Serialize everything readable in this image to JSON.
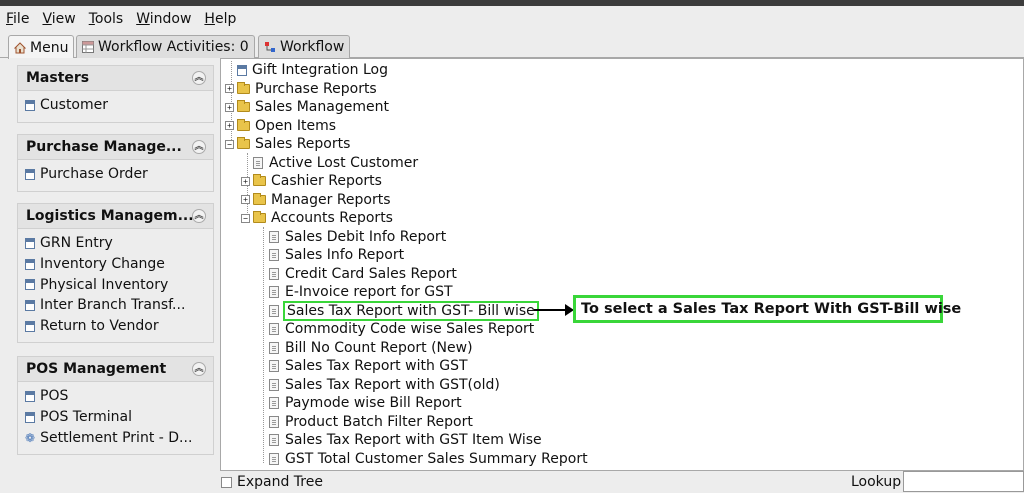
{
  "menubar": [
    "File",
    "View",
    "Tools",
    "Window",
    "Help"
  ],
  "tabs": [
    {
      "label": "Menu",
      "icon": "home-icon"
    },
    {
      "label": "Workflow Activities: 0",
      "icon": "grid-icon"
    },
    {
      "label": "Workflow",
      "icon": "workflow-icon"
    }
  ],
  "sidebar": {
    "sections": [
      {
        "title": "Masters",
        "items": [
          {
            "label": "Customer",
            "icon": "doc-icon"
          }
        ]
      },
      {
        "title": "Purchase Manage...",
        "items": [
          {
            "label": "Purchase Order",
            "icon": "doc-icon"
          }
        ]
      },
      {
        "title": "Logistics Managem...",
        "items": [
          {
            "label": "GRN Entry",
            "icon": "doc-icon"
          },
          {
            "label": "Inventory Change",
            "icon": "doc-icon"
          },
          {
            "label": "Physical Inventory",
            "icon": "doc-icon"
          },
          {
            "label": "Inter Branch Transf...",
            "icon": "doc-icon"
          },
          {
            "label": "Return to Vendor",
            "icon": "doc-icon"
          }
        ]
      },
      {
        "title": "POS Management",
        "items": [
          {
            "label": "POS",
            "icon": "doc-icon"
          },
          {
            "label": "POS Terminal",
            "icon": "doc-icon"
          },
          {
            "label": "Settlement Print - D...",
            "icon": "gear-icon"
          }
        ]
      }
    ]
  },
  "tree": [
    {
      "label": "Gift Integration Log",
      "type": "item",
      "level": 0
    },
    {
      "label": "Purchase Reports",
      "type": "folder",
      "level": 0,
      "expanded": false
    },
    {
      "label": "Sales Management",
      "type": "folder",
      "level": 0,
      "expanded": false
    },
    {
      "label": "Open Items",
      "type": "folder",
      "level": 0,
      "expanded": false
    },
    {
      "label": "Sales Reports",
      "type": "folder",
      "level": 0,
      "expanded": true
    },
    {
      "label": "Active Lost Customer",
      "type": "leaf",
      "level": 1
    },
    {
      "label": "Cashier Reports",
      "type": "folder",
      "level": 1,
      "expanded": false
    },
    {
      "label": "Manager Reports",
      "type": "folder",
      "level": 1,
      "expanded": false
    },
    {
      "label": "Accounts Reports",
      "type": "folder",
      "level": 1,
      "expanded": true
    },
    {
      "label": "Sales Debit Info Report",
      "type": "leaf",
      "level": 2
    },
    {
      "label": "Sales Info Report",
      "type": "leaf",
      "level": 2
    },
    {
      "label": "Credit Card Sales Report",
      "type": "leaf",
      "level": 2
    },
    {
      "label": "E-Invoice report for GST",
      "type": "leaf",
      "level": 2
    },
    {
      "label": "Sales Tax Report with GST- Bill wise",
      "type": "leaf",
      "level": 2,
      "highlighted": true
    },
    {
      "label": "Commodity Code wise Sales Report",
      "type": "leaf",
      "level": 2
    },
    {
      "label": "Bill No Count Report (New)",
      "type": "leaf",
      "level": 2
    },
    {
      "label": "Sales Tax Report with GST",
      "type": "leaf",
      "level": 2
    },
    {
      "label": "Sales Tax Report with GST(old)",
      "type": "leaf",
      "level": 2
    },
    {
      "label": "Paymode wise Bill Report",
      "type": "leaf",
      "level": 2
    },
    {
      "label": "Product Batch Filter Report",
      "type": "leaf",
      "level": 2
    },
    {
      "label": "Sales Tax Report with GST Item Wise",
      "type": "leaf",
      "level": 2
    },
    {
      "label": "GST Total Customer Sales Summary Report",
      "type": "leaf",
      "level": 2
    }
  ],
  "callout": {
    "text": "To select a Sales Tax Report With GST-Bill wise",
    "color": "#39d639"
  },
  "status": {
    "expand_tree": "Expand Tree",
    "lookup_label": "Lookup",
    "lookup_value": ""
  }
}
